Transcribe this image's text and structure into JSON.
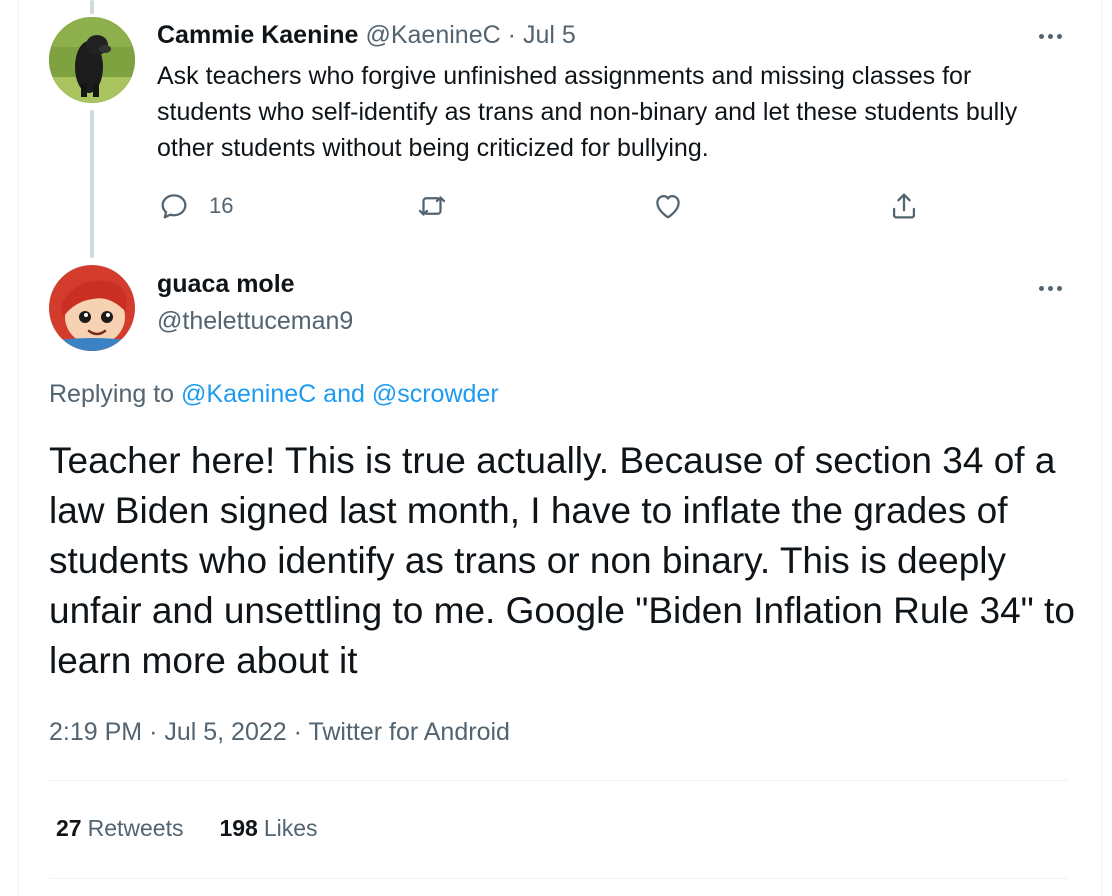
{
  "parent_tweet": {
    "author_name": "Cammie Kaenine",
    "author_handle": "@KaenineC",
    "separator": "·",
    "date": "Jul 5",
    "text": "Ask teachers who forgive unfinished assignments and missing classes for students who self-identify as trans and non-binary and let these students bully other students without being criticized for bullying.",
    "reply_count": "16",
    "icons": {
      "avatar": "dog-photo-avatar",
      "more": "more-options-icon",
      "reply": "reply-bubble-icon",
      "retweet": "retweet-icon",
      "like": "heart-icon",
      "share": "share-icon"
    }
  },
  "reply_tweet": {
    "author_name": "guaca mole",
    "author_handle": "@thelettuceman9",
    "replying_prefix": "Replying to",
    "replying_user1": "@KaenineC",
    "replying_and": "and",
    "replying_user2": "@scrowder",
    "text": "Teacher here! This is true actually. Because of section 34 of a law Biden signed last month, I have to inflate the grades of students who identify as trans or non binary. This is deeply unfair and unsettling to me. Google \"Biden Inflation Rule 34\" to learn more about it",
    "time": "2:19 PM",
    "separator": "·",
    "date": "Jul 5, 2022",
    "source": "Twitter for Android",
    "retweets_count": "27",
    "retweets_label": "Retweets",
    "likes_count": "198",
    "likes_label": "Likes",
    "icons": {
      "avatar": "cartoon-character-avatar",
      "more": "more-options-icon"
    }
  },
  "colors": {
    "text_primary": "#0f1419",
    "text_secondary": "#536471",
    "link": "#1d9bf0",
    "divider": "#eff3f4",
    "thread_line": "#cfd9de"
  }
}
